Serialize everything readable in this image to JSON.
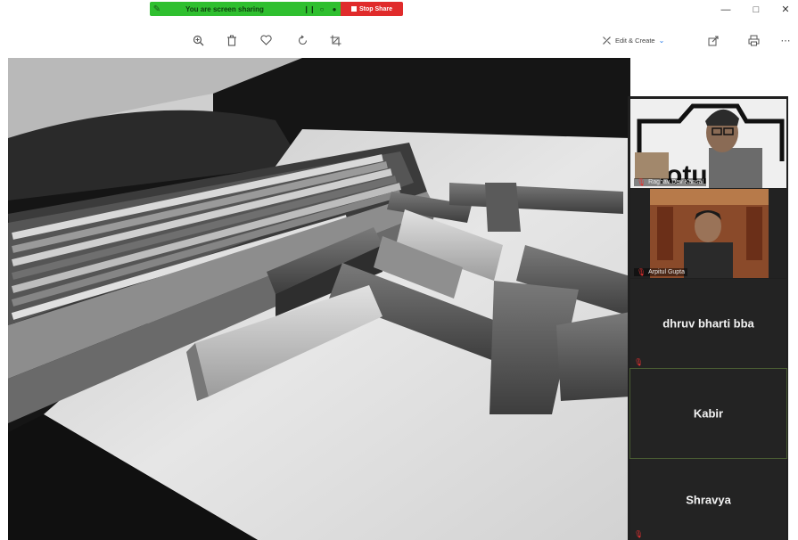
{
  "share_banner": {
    "status_text": "You are screen sharing",
    "stop_label": "Stop Share",
    "pin_icon": "pin-icon",
    "share_icons": [
      "pause-icon",
      "annotate-icon",
      "more-icon"
    ]
  },
  "window_controls": [
    "minimize-icon",
    "maximize-icon",
    "close-icon"
  ],
  "toolbar": {
    "icons": [
      "zoom-in-icon",
      "delete-icon",
      "favorite-icon",
      "rotate-icon",
      "crop-icon"
    ],
    "edit_create_label": "Edit & Create",
    "right_icons": [
      "share-icon",
      "print-icon",
      "more-options-icon"
    ]
  },
  "participants": [
    {
      "name": "Raghav Dev Kansal",
      "video": true,
      "muted": true
    },
    {
      "name": "Arpitul Gupta",
      "video": true,
      "muted": true
    },
    {
      "name": "dhruv bharti bba",
      "video": false,
      "muted": true
    },
    {
      "name": "Kabir",
      "video": false,
      "muted": false,
      "active": true
    },
    {
      "name": "Shravya",
      "video": false,
      "muted": true
    }
  ],
  "colors": {
    "share_green": "#2fbf2f",
    "stop_red": "#e02b2b",
    "gallery_bg": "#1f1f1f",
    "mic_muted": "#e23030"
  }
}
